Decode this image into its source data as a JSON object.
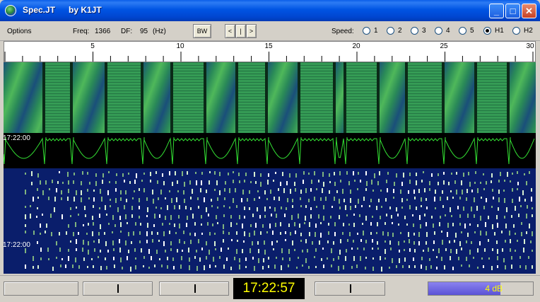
{
  "window": {
    "app_name": "Spec.JT",
    "author": "by K1JT",
    "buttons": {
      "minimize": "_",
      "maximize": "□",
      "close": "✕"
    }
  },
  "toolbar": {
    "options_label": "Options",
    "freq_label": "Freq:",
    "freq_value": "1366",
    "df_label": "DF:",
    "df_value": "95",
    "df_unit": "(Hz)",
    "bw_button": "BW",
    "nav_left": "<",
    "nav_center": "|",
    "nav_right": ">",
    "speed_label": "Speed:",
    "speed_options": [
      "1",
      "2",
      "3",
      "4",
      "5",
      "H1",
      "H2"
    ],
    "speed_selected": "H1"
  },
  "scale": {
    "labels": [
      "5",
      "10",
      "15",
      "20",
      "25",
      "30"
    ]
  },
  "spectrogram": {
    "timestamp_top": "17:22:00",
    "timestamp_bottom": "17:22:00",
    "colors": {
      "trace": "#33e033",
      "waterfall_bg": "#0a1e6b",
      "spec_green": "#1f6f3c"
    }
  },
  "statusbar": {
    "clock": "17:22:57",
    "gain": "4 dB",
    "gain_fraction": 0.69
  }
}
